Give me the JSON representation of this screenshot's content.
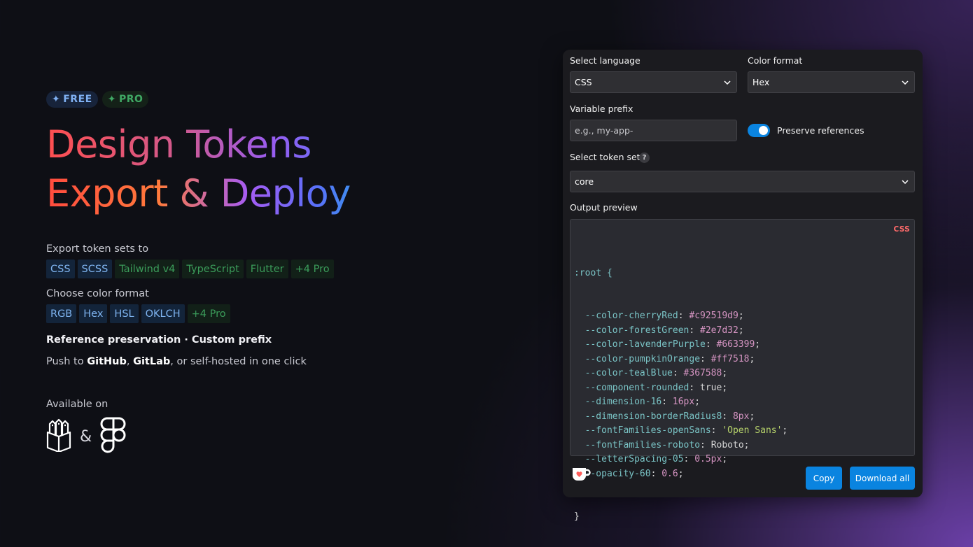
{
  "hero": {
    "badges": {
      "free": "FREE",
      "pro": "PRO",
      "spark": "✦"
    },
    "title_line1_part1": "Design",
    "title_line1_part2": "Tokens",
    "title_line2_part1": "Export",
    "title_line2_amp": "&",
    "title_line2_part2": "Deploy",
    "export_label": "Export token sets to",
    "export_chips": [
      "CSS",
      "SCSS",
      "Tailwind v4",
      "TypeScript",
      "Flutter",
      "+4 Pro"
    ],
    "color_label": "Choose color format",
    "color_chips": [
      "RGB",
      "Hex",
      "HSL",
      "OKLCH",
      "+4 Pro"
    ],
    "feature_line": "Reference preservation · Custom prefix",
    "push_prefix": "Push to ",
    "push_github": "GitHub",
    "push_sep": ", ",
    "push_gitlab": "GitLab",
    "push_suffix": ", or self-hosted in one click",
    "available_label": "Available on",
    "available_amp": "&",
    "platform_icons": [
      "penpot-icon",
      "figma-icon"
    ]
  },
  "panel": {
    "language_label": "Select language",
    "language_value": "CSS",
    "format_label": "Color format",
    "format_value": "Hex",
    "prefix_label": "Variable prefix",
    "prefix_placeholder": "e.g., my-app-",
    "preserve_label": "Preserve references",
    "preserve_on": true,
    "token_set_label": "Select token set",
    "help_mark": "?",
    "token_set_value": "core",
    "output_label": "Output preview",
    "output_tag": "CSS",
    "code": {
      "open": ":root {",
      "close": "}",
      "lines": [
        {
          "prop": "--color-cherryRed",
          "value": "#c92519d9",
          "kind": "val"
        },
        {
          "prop": "--color-forestGreen",
          "value": "#2e7d32",
          "kind": "val"
        },
        {
          "prop": "--color-lavenderPurple",
          "value": "#663399",
          "kind": "val"
        },
        {
          "prop": "--color-pumpkinOrange",
          "value": "#ff7518",
          "kind": "val"
        },
        {
          "prop": "--color-tealBlue",
          "value": "#367588",
          "kind": "val"
        },
        {
          "prop": "--component-rounded",
          "value": "true",
          "kind": "plain"
        },
        {
          "prop": "--dimension-16",
          "value": "16px",
          "kind": "val"
        },
        {
          "prop": "--dimension-borderRadius8",
          "value": "8px",
          "kind": "val"
        },
        {
          "prop": "--fontFamilies-openSans",
          "value": "'Open Sans'",
          "kind": "str"
        },
        {
          "prop": "--fontFamilies-roboto",
          "value": "Roboto",
          "kind": "plain"
        },
        {
          "prop": "--letterSpacing-05",
          "value": "0.5px",
          "kind": "val"
        },
        {
          "prop": "--opacity-60",
          "value": "0.6",
          "kind": "val"
        }
      ]
    },
    "copy_label": "Copy",
    "download_label": "Download all",
    "colors": {
      "accent": "#0a84e0",
      "panel_bg": "#1b1b1f"
    }
  }
}
